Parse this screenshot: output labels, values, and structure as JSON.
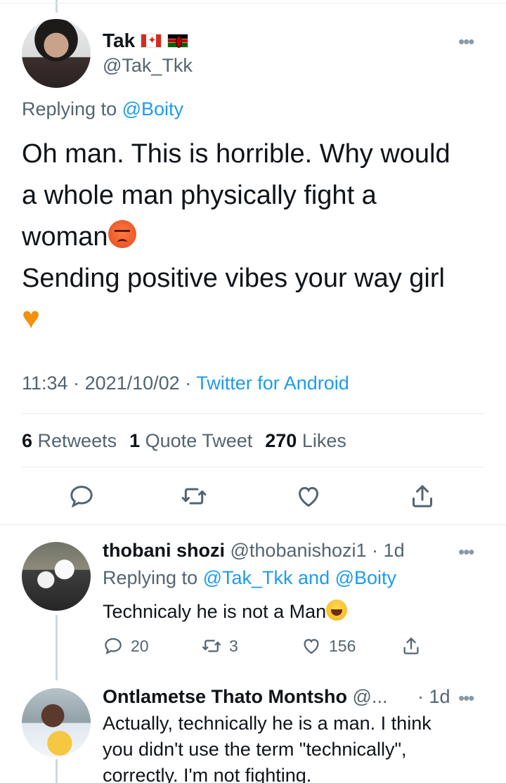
{
  "main_tweet": {
    "display_name": "Tak",
    "flags": [
      "canada-flag",
      "kenya-flag"
    ],
    "handle": "@Tak_Tkk",
    "replying_prefix": "Replying to ",
    "replying_to": "@Boity",
    "text_line1": "Oh man. This is horrible. Why would",
    "text_line2": "a whole man physically fight a",
    "text_line3": "woman",
    "text_line4": "Sending positive vibes your way girl",
    "emojis": [
      "angry-face-emoji",
      "orange-heart-emoji"
    ],
    "time": "11:34",
    "date": "2021/10/02",
    "source": "Twitter for Android",
    "retweets_count": "6",
    "retweets_label": "Retweets",
    "quotes_count": "1",
    "quotes_label": "Quote Tweet",
    "likes_count": "270",
    "likes_label": "Likes",
    "action_icons": [
      "reply-icon",
      "retweet-icon",
      "like-icon",
      "share-icon"
    ]
  },
  "replies": [
    {
      "display_name": "thobani shozi",
      "handle": "@thobanishozi1",
      "age": "1d",
      "replying_prefix": "Replying to ",
      "replying_to_1": "@Tak_Tkk",
      "replying_and": " and ",
      "replying_to_2": "@Boity",
      "text": "Technicaly he is not a Man",
      "emoji": "tears-of-joy-emoji",
      "reply_count": "20",
      "retweet_count": "3",
      "like_count": "156"
    },
    {
      "display_name": "Ontlametse Thato Montsho",
      "handle": "@...",
      "age": "1d",
      "text_line1": "Actually, technically he is a man. I think",
      "text_line2": "you didn't use the term \"technically\",",
      "text_line3": "correctly. I'm not fighting."
    }
  ],
  "colors": {
    "link": "#1d9bf0",
    "secondary_text": "#536471",
    "primary_text": "#0f1419",
    "divider": "#e6ecf0",
    "thread_line": "#cfd9de"
  }
}
